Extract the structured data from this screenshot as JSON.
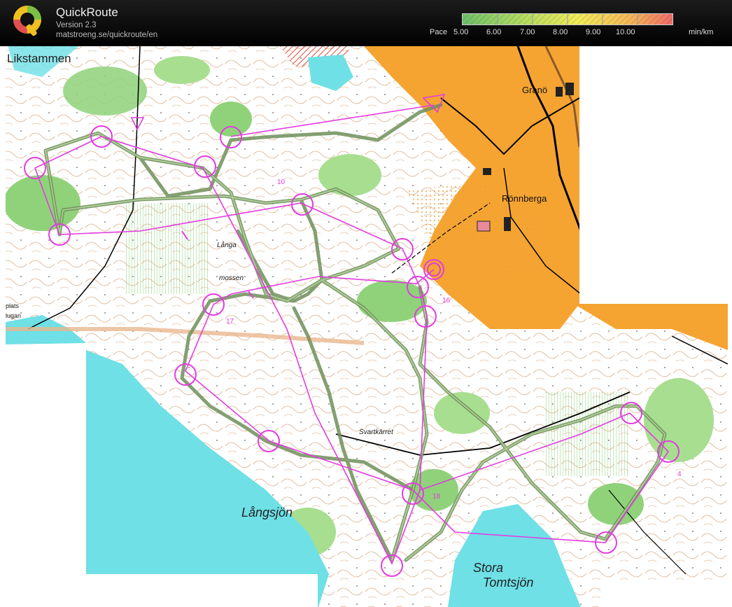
{
  "app": {
    "title": "QuickRoute",
    "version": "Version 2.3",
    "url": "matstroeng.se/quickroute/en"
  },
  "pace_legend": {
    "label": "Pace",
    "ticks": [
      "5.00",
      "6.00",
      "7.00",
      "8.00",
      "9.00",
      "10.00"
    ],
    "unit": "min/km"
  },
  "map_labels": {
    "likstammen": "Likstammen",
    "grano": "Granö",
    "ronnberga": "Rönnberga",
    "langa": "Långa",
    "mossen": "mossen",
    "svartkarret": "Svartkärret",
    "langsjon": "Långsjön",
    "stora": "Stora",
    "tomtsjon": "Tomtsjön",
    "control_10": "10",
    "control_16": "16",
    "control_17": "17",
    "control_18": "18",
    "control_4": "4",
    "fragment_plats": "plats",
    "fragment_lugan": "lugan"
  },
  "colors": {
    "open_land": "#f5a431",
    "forest_green": "#8fd27a",
    "water": "#6ee0e6",
    "course_magenta": "#e23ce0",
    "route_line": "#6f8f5a",
    "contour": "#b5651d"
  }
}
